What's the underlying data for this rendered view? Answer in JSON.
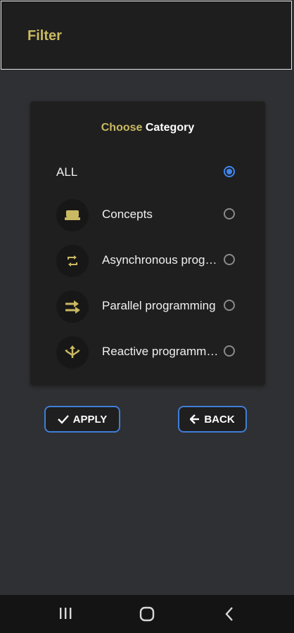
{
  "appbar": {
    "title": "Filter"
  },
  "card": {
    "title_accent": "Choose",
    "title_rest": "Category",
    "options": [
      {
        "label": "ALL",
        "icon": "none",
        "selected": true
      },
      {
        "label": "Concepts",
        "icon": "layers-icon",
        "selected": false
      },
      {
        "label": "Asynchronous programming",
        "icon": "sync-icon",
        "selected": false
      },
      {
        "label": "Parallel programming",
        "icon": "parallel-arrows-icon",
        "selected": false
      },
      {
        "label": "Reactive programming",
        "icon": "fork-icon",
        "selected": false
      }
    ]
  },
  "buttons": {
    "apply": "APPLY",
    "back": "BACK"
  },
  "navbar": {
    "items": [
      "recent-apps-icon",
      "home-icon",
      "back-nav-icon"
    ]
  },
  "colors": {
    "accent": "#c9b962",
    "radio_selected": "#3f86ef",
    "button_border": "#3f7ed8"
  }
}
